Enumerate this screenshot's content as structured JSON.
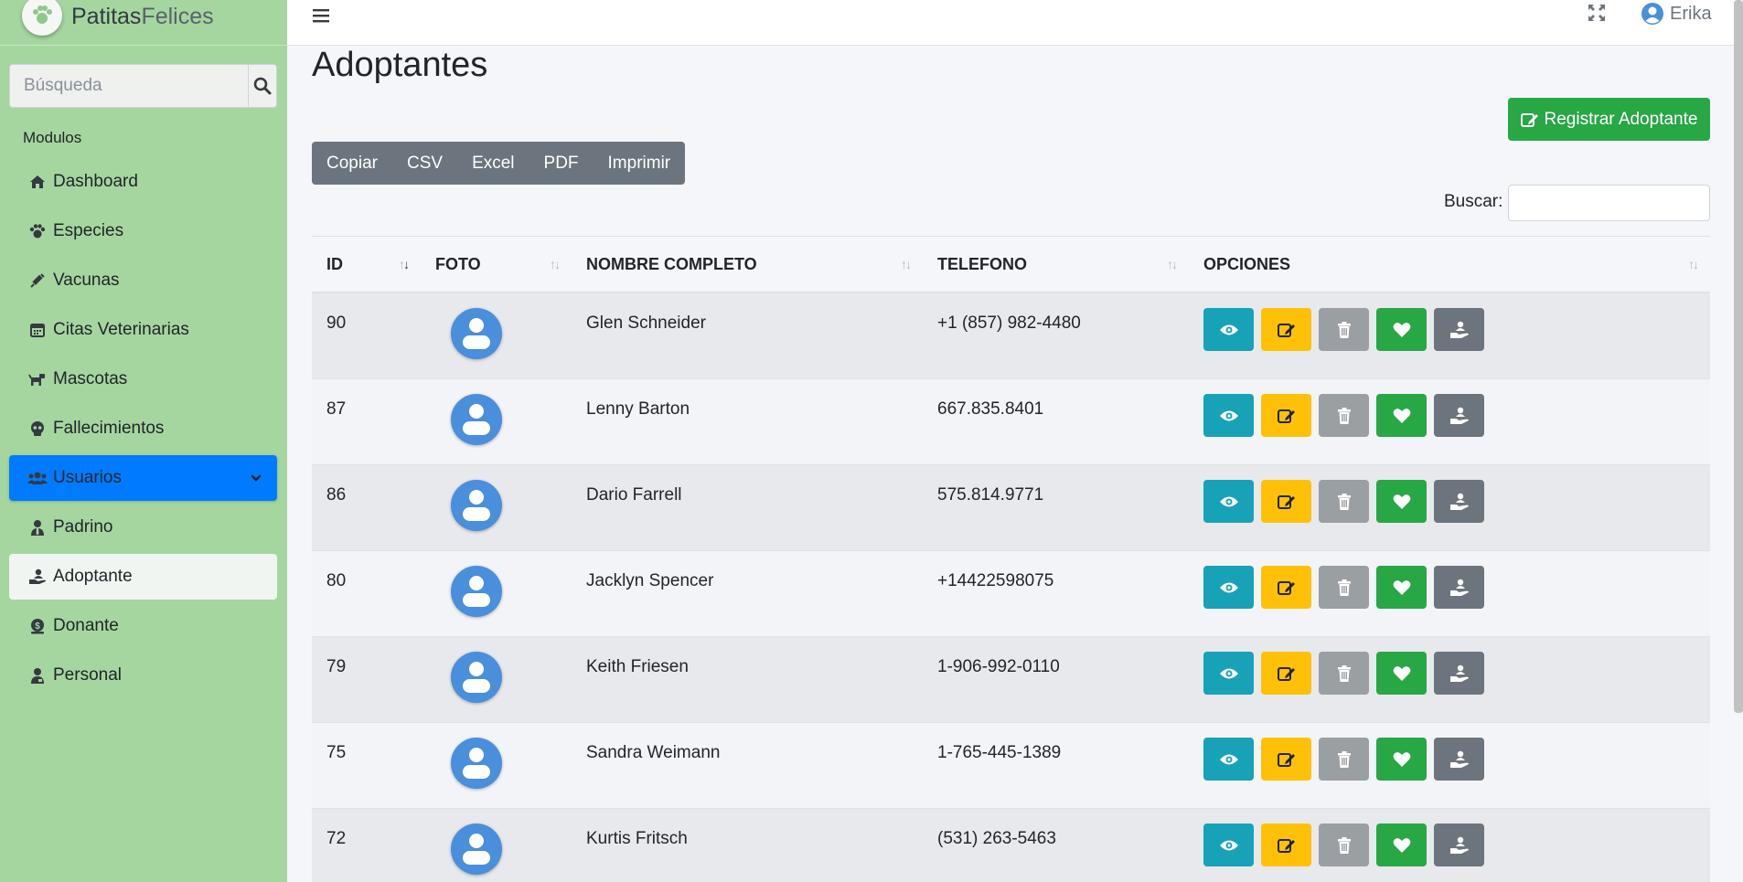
{
  "brand": {
    "name_a": "Patitas",
    "name_b": "Felices"
  },
  "sidebar": {
    "search_placeholder": "Búsqueda",
    "header": "Modulos",
    "items": [
      {
        "label": "Dashboard",
        "icon": "home-icon"
      },
      {
        "label": "Especies",
        "icon": "paw-icon"
      },
      {
        "label": "Vacunas",
        "icon": "syringe-icon"
      },
      {
        "label": "Citas Veterinarias",
        "icon": "calendar-icon"
      },
      {
        "label": "Mascotas",
        "icon": "dog-icon"
      },
      {
        "label": "Fallecimientos",
        "icon": "skull-icon"
      },
      {
        "label": "Usuarios",
        "icon": "users-icon",
        "state": "expanded"
      },
      {
        "label": "Padrino",
        "icon": "user-tie-icon"
      },
      {
        "label": "Adoptante",
        "icon": "hand-holding-user-icon",
        "state": "selected"
      },
      {
        "label": "Donante",
        "icon": "donate-icon"
      },
      {
        "label": "Personal",
        "icon": "user-badge-icon"
      }
    ]
  },
  "topbar": {
    "user_name": "Erika"
  },
  "page": {
    "title": "Adoptantes",
    "register_label": "Registrar Adoptante",
    "export_buttons": [
      "Copiar",
      "CSV",
      "Excel",
      "PDF",
      "Imprimir"
    ],
    "search_label": "Buscar:"
  },
  "table": {
    "columns": [
      "ID",
      "FOTO",
      "NOMBRE COMPLETO",
      "TELEFONO",
      "OPCIONES"
    ],
    "rows": [
      {
        "id": "90",
        "name": "Glen Schneider",
        "phone": "+1 (857) 982-4480"
      },
      {
        "id": "87",
        "name": "Lenny Barton",
        "phone": "667.835.8401"
      },
      {
        "id": "86",
        "name": "Dario Farrell",
        "phone": "575.814.9771"
      },
      {
        "id": "80",
        "name": "Jacklyn Spencer",
        "phone": "+14422598075"
      },
      {
        "id": "79",
        "name": "Keith Friesen",
        "phone": "1-906-992-0110"
      },
      {
        "id": "75",
        "name": "Sandra Weimann",
        "phone": "1-765-445-1389"
      },
      {
        "id": "72",
        "name": "Kurtis Fritsch",
        "phone": "(531) 263-5463"
      }
    ]
  },
  "colors": {
    "sidebar_bg": "#a5d6a0",
    "primary": "#007bff",
    "success": "#28a745",
    "info": "#17a2b8",
    "warning": "#ffc107",
    "secondary": "#6c757d"
  }
}
